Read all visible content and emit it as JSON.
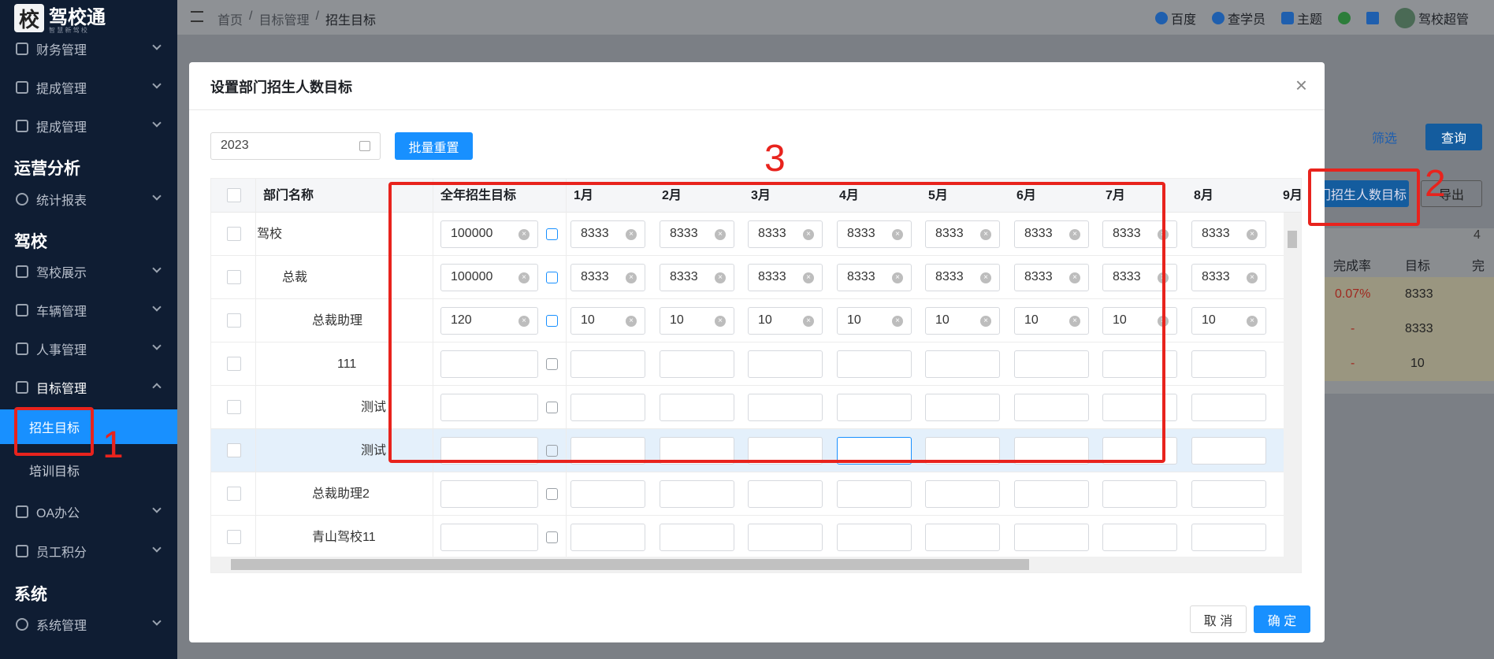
{
  "logo": {
    "text": "驾校通",
    "badge": "校",
    "sub": "智 慧 新 驾 校"
  },
  "sidebar": {
    "items": [
      {
        "label": "财务管理"
      },
      {
        "label": "提成管理"
      },
      {
        "label": "提成管理"
      },
      {
        "label": "统计报表"
      },
      {
        "label": "驾校展示"
      },
      {
        "label": "车辆管理"
      },
      {
        "label": "人事管理"
      },
      {
        "label": "目标管理"
      },
      {
        "label": "OA办公"
      },
      {
        "label": "员工积分"
      },
      {
        "label": "系统管理"
      }
    ],
    "sections": [
      "运营分析",
      "驾校",
      "系统"
    ],
    "subs": [
      {
        "label": "招生目标"
      },
      {
        "label": "培训目标"
      }
    ]
  },
  "breadcrumb": [
    "首页",
    "/",
    "目标管理",
    "/",
    "招生目标"
  ],
  "topbar": {
    "baidu": "百度",
    "student": "查学员",
    "theme": "主题",
    "user": "驾校超管"
  },
  "bg": {
    "filter": "筛选",
    "query": "查询",
    "set_target": "门招生人数目标",
    "export": "导出",
    "num4": "4",
    "col_rate": "完成率",
    "col_target": "目标",
    "col_done": "完",
    "r1_rate": "0.07%",
    "r1_target": "8333",
    "r2_rate": "-",
    "r2_target": "8333",
    "r3_rate": "-",
    "r3_target": "10"
  },
  "modal": {
    "title": "设置部门招生人数目标",
    "year": "2023",
    "batch_reset": "批量重置",
    "cancel": "取 消",
    "confirm": "确 定",
    "headers": {
      "dept": "部门名称",
      "annual": "全年招生目标",
      "m1": "1月",
      "m2": "2月",
      "m3": "3月",
      "m4": "4月",
      "m5": "5月",
      "m6": "6月",
      "m7": "7月",
      "m8": "8月",
      "m9": "9月"
    },
    "rows": [
      {
        "dept": "驾校",
        "annual": "100000",
        "months": [
          "8333",
          "8333",
          "8333",
          "8333",
          "8333",
          "8333",
          "8333",
          "8333"
        ]
      },
      {
        "dept": "总裁",
        "annual": "100000",
        "months": [
          "8333",
          "8333",
          "8333",
          "8333",
          "8333",
          "8333",
          "8333",
          "8333"
        ]
      },
      {
        "dept": "总裁助理",
        "annual": "120",
        "months": [
          "10",
          "10",
          "10",
          "10",
          "10",
          "10",
          "10",
          "10"
        ]
      },
      {
        "dept": "111",
        "annual": "",
        "months": [
          "",
          "",
          "",
          "",
          "",
          "",
          "",
          ""
        ]
      },
      {
        "dept": "测试",
        "annual": "",
        "months": [
          "",
          "",
          "",
          "",
          "",
          "",
          "",
          ""
        ]
      },
      {
        "dept": "测试",
        "annual": "",
        "months": [
          "",
          "",
          "",
          "",
          "",
          "",
          "",
          ""
        ]
      },
      {
        "dept": "总裁助理2",
        "annual": "",
        "months": [
          "",
          "",
          "",
          "",
          "",
          "",
          "",
          ""
        ]
      },
      {
        "dept": "青山驾校11",
        "annual": "",
        "months": [
          "",
          "",
          "",
          "",
          "",
          "",
          "",
          ""
        ]
      }
    ]
  },
  "annotations": {
    "n1": "1",
    "n2": "2",
    "n3": "3"
  }
}
